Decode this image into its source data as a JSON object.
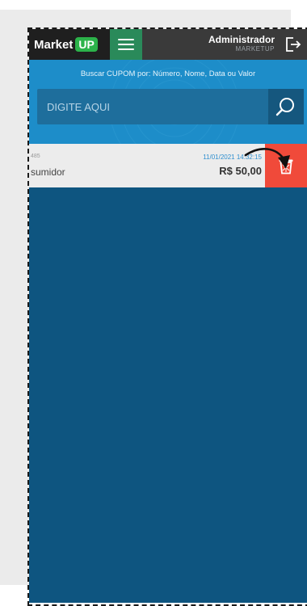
{
  "header": {
    "logo_text": "Market",
    "logo_badge": "UP",
    "user_name": "Administrador",
    "user_org": "MARKETUP"
  },
  "search": {
    "hint": "Buscar CUPOM por: Número, Nome, Data ou Valor",
    "placeholder": "DIGITE AQUI"
  },
  "coupons": [
    {
      "id": "485",
      "name": "sumidor",
      "datetime": "11/01/2021 14:32:15",
      "value": "R$ 50,00"
    }
  ],
  "colors": {
    "accent": "#1d8dc9",
    "body_background": "#0e5580",
    "delete": "#f04a3a",
    "brand_green": "#2cb34a"
  },
  "icons": [
    "menu-icon",
    "logout-icon",
    "search-icon",
    "trash-icon",
    "arrow-annotation"
  ]
}
